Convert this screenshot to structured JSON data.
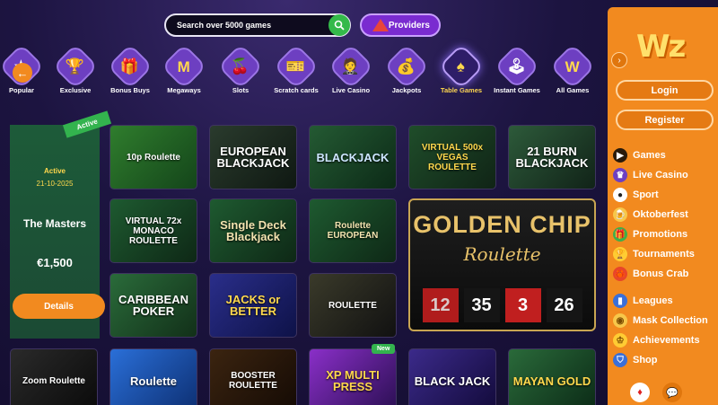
{
  "search": {
    "placeholder": "Search over 5000 games"
  },
  "providers": {
    "label": "Providers"
  },
  "categories": [
    {
      "label": "Popular",
      "icon": "star-icon"
    },
    {
      "label": "Exclusive",
      "icon": "trophy-icon"
    },
    {
      "label": "Bonus Buys",
      "icon": "gift-icon"
    },
    {
      "label": "Megaways",
      "icon": "m-letter-icon"
    },
    {
      "label": "Slots",
      "icon": "cherries-icon"
    },
    {
      "label": "Scratch cards",
      "icon": "ticket-icon"
    },
    {
      "label": "Live Casino",
      "icon": "dealer-icon"
    },
    {
      "label": "Jackpots",
      "icon": "money-bag-icon"
    },
    {
      "label": "Table Games",
      "icon": "spade-icon",
      "active": true
    },
    {
      "label": "Instant Games",
      "icon": "joystick-icon"
    },
    {
      "label": "All Games",
      "icon": "w-letter-icon"
    }
  ],
  "tournament": {
    "badge": "Active",
    "status": "Active",
    "date": "21-10-2025",
    "name": "The Masters",
    "prize": "€1,500",
    "details_label": "Details"
  },
  "games": [
    {
      "title": "10p Roulette"
    },
    {
      "title": "EUROPEAN BLACKJACK"
    },
    {
      "title": "BLACKJACK"
    },
    {
      "title": "VIRTUAL 500x VEGAS ROULETTE"
    },
    {
      "title": "21 BURN BLACKJACK"
    },
    {
      "title": "VIRTUAL 72x MONACO ROULETTE"
    },
    {
      "title": "Single Deck Blackjack"
    },
    {
      "title": "Roulette EUROPEAN"
    },
    {
      "title": "CARIBBEAN POKER"
    },
    {
      "title": "JACKS or BETTER"
    },
    {
      "title": "ROULETTE"
    },
    {
      "title": "Zoom Roulette"
    },
    {
      "title": "Roulette"
    },
    {
      "title": "BOOSTER ROULETTE"
    },
    {
      "title": "XP MULTI PRESS"
    },
    {
      "title": "BLACK JACK"
    },
    {
      "title": "MAYAN GOLD"
    }
  ],
  "new_badge": "New",
  "featured": {
    "title": "GOLDEN CHIP",
    "subtitle": "Roulette",
    "numbers": [
      "12",
      "35",
      "3",
      "26"
    ]
  },
  "sidebar": {
    "logo": "Wz",
    "login_label": "Login",
    "register_label": "Register",
    "menu": [
      {
        "label": "Games",
        "icon": "play-icon"
      },
      {
        "label": "Live Casino",
        "icon": "dealer-icon"
      },
      {
        "label": "Sport",
        "icon": "soccer-ball-icon"
      },
      {
        "label": "Oktoberfest",
        "icon": "beer-icon"
      },
      {
        "label": "Promotions",
        "icon": "gift-icon"
      },
      {
        "label": "Tournaments",
        "icon": "trophy-icon"
      },
      {
        "label": "Bonus Crab",
        "icon": "crab-icon"
      },
      {
        "label": "Leagues",
        "icon": "league-icon"
      },
      {
        "label": "Mask Collection",
        "icon": "mask-icon"
      },
      {
        "label": "Achievements",
        "icon": "crown-icon"
      },
      {
        "label": "Shop",
        "icon": "shop-icon"
      }
    ]
  }
}
